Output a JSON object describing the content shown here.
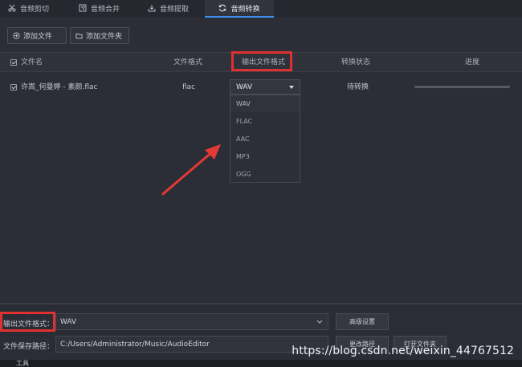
{
  "tabs": [
    {
      "label": "音频剪切",
      "icon": "scissors-icon"
    },
    {
      "label": "音频合并",
      "icon": "merge-icon"
    },
    {
      "label": "音频提取",
      "icon": "extract-icon"
    },
    {
      "label": "音频转换",
      "icon": "convert-icon",
      "active": true
    }
  ],
  "toolbar": {
    "add_file": "添加文件",
    "add_folder": "添加文件夹"
  },
  "table": {
    "headers": {
      "name": "文件名",
      "format": "文件格式",
      "output_format": "输出文件格式",
      "status": "转换状态",
      "progress": "进度"
    },
    "rows": [
      {
        "name": "许嵩_何曼婷 - 素颜.flac",
        "format": "flac",
        "output_format": "WAV",
        "status": "待转换",
        "progress": 0.0
      }
    ]
  },
  "dropdown": {
    "options": [
      "WAV",
      "FLAC",
      "AAC",
      "MP3",
      "OGG"
    ]
  },
  "bottom": {
    "output_format_label": "输出文件格式：",
    "output_format_value": "WAV",
    "advanced_button": "高级设置",
    "save_path_label": "文件保存路径：",
    "save_path_value": "C:/Users/Administrator/Music/AudioEditor",
    "change_path_button": "更改路径",
    "open_folder_button": "打开文件夹"
  },
  "watermark": "https://blog.csdn.net/weixin_44767512",
  "taskbar_label": "工具",
  "colors": {
    "accent": "#3d8ef0",
    "highlight": "#e03131",
    "arrow": "#e53935"
  }
}
